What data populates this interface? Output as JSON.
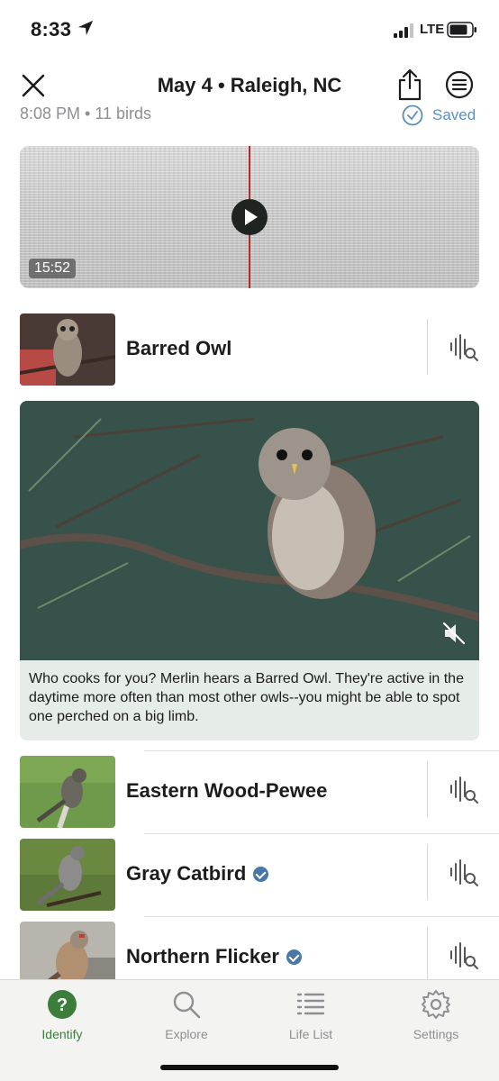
{
  "status_bar": {
    "time": "8:33",
    "network": "LTE",
    "icons": [
      "location-arrow-icon",
      "signal-icon",
      "battery-icon"
    ]
  },
  "header": {
    "title": "May 4 • Raleigh, NC",
    "icons": [
      "close-icon",
      "share-icon",
      "menu-icon"
    ]
  },
  "recording": {
    "subinfo": "8:08 PM • 11 birds",
    "saved_label": "Saved",
    "duration": "15:52"
  },
  "birds": [
    {
      "name": "Barred Owl",
      "verified": false
    },
    {
      "name": "Eastern Wood-Pewee",
      "verified": false
    },
    {
      "name": "Gray Catbird",
      "verified": true
    },
    {
      "name": "Northern Flicker",
      "verified": true
    }
  ],
  "feature": {
    "text": "Who cooks for you? Merlin hears a Barred Owl. They're active in the daytime more often than most other owls--you might be able to spot one perched on a big limb."
  },
  "tabs": [
    {
      "label": "Identify",
      "icon": "identify-icon",
      "active": true
    },
    {
      "label": "Explore",
      "icon": "search-icon",
      "active": false
    },
    {
      "label": "Life List",
      "icon": "list-icon",
      "active": false
    },
    {
      "label": "Settings",
      "icon": "gear-icon",
      "active": false
    }
  ],
  "colors": {
    "accent_green": "#3c7d3c",
    "saved_blue": "#5a8fc0",
    "verified_blue": "#4a78a6",
    "playhead_red": "#b32a2a"
  }
}
